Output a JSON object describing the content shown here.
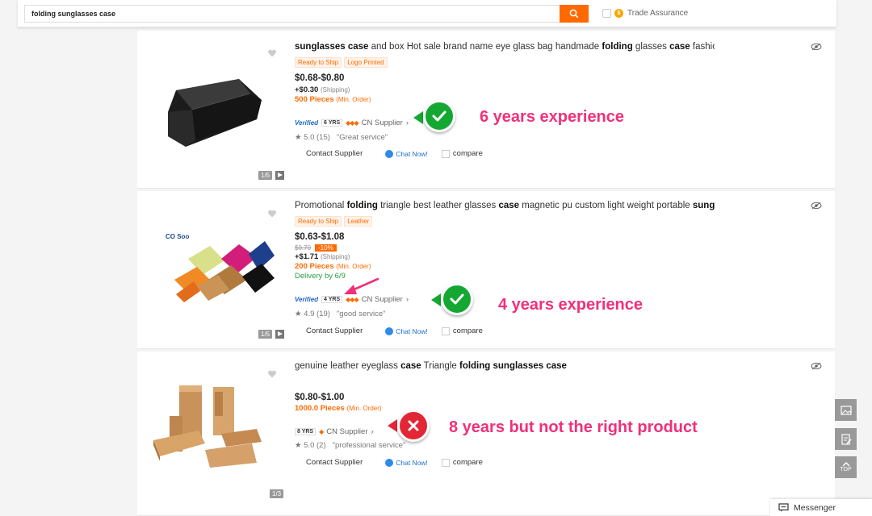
{
  "search": {
    "query": "folding sunglasses case",
    "trade_assurance_label": "Trade Assurance",
    "trade_assurance_badge": "$"
  },
  "products": [
    {
      "title_parts": [
        {
          "t": "sunglasses case",
          "b": true
        },
        {
          "t": " and box Hot sale brand name eye glass bag handmade ",
          "b": false
        },
        {
          "t": "folding",
          "b": true
        },
        {
          "t": " glasses ",
          "b": false
        },
        {
          "t": "case",
          "b": true
        },
        {
          "t": " fashion s...",
          "b": false
        }
      ],
      "tags": [
        "Ready to Ship",
        "Logo Printed"
      ],
      "price": "$0.68-$0.80",
      "shipping": "+$0.30",
      "shipping_label": "(Shipping)",
      "moq": "500 Pieces",
      "moq_label": "(Min. Order)",
      "verified": "Verified",
      "years": "6 YRS",
      "supplier": "CN Supplier",
      "rating": "5.0 (15)",
      "review": "\"Great service\"",
      "image_count": "1/5",
      "annotation": "6 years experience"
    },
    {
      "title_parts": [
        {
          "t": "Promotional ",
          "b": false
        },
        {
          "t": "folding",
          "b": true
        },
        {
          "t": " triangle best leather glasses ",
          "b": false
        },
        {
          "t": "case",
          "b": true
        },
        {
          "t": " magnetic pu custom light weight portable ",
          "b": false
        },
        {
          "t": "sungl...",
          "b": true
        }
      ],
      "tags": [
        "Ready to Ship",
        "Leather"
      ],
      "price": "$0.63-$1.08",
      "old_price": "$0.70",
      "discount": "-10%",
      "shipping": "+$1.71",
      "shipping_label": "(Shipping)",
      "moq": "200 Pieces",
      "moq_label": "(Min. Order)",
      "delivery": "Delivery by 6/9",
      "verified": "Verified",
      "years": "4 YRS",
      "supplier": "CN Supplier",
      "rating": "4.9 (19)",
      "review": "\"good service\"",
      "image_count": "1/5",
      "logo_text": "CO Soo",
      "annotation": "4 years experience"
    },
    {
      "title_parts": [
        {
          "t": "genuine leather eyeglass ",
          "b": false
        },
        {
          "t": "case",
          "b": true
        },
        {
          "t": " Triangle ",
          "b": false
        },
        {
          "t": "folding sunglasses case",
          "b": true
        }
      ],
      "price": "$0.80-$1.00",
      "moq": "1000.0 Pieces",
      "moq_label": "(Min. Order)",
      "years": "8 YRS",
      "supplier": "CN Supplier",
      "rating": "5.0 (2)",
      "review": "\"professional service\"",
      "image_count": "1/3",
      "annotation": "8 years but not the right product"
    }
  ],
  "actions": {
    "contact": "Contact Supplier",
    "chat": "Chat Now!",
    "compare": "compare"
  },
  "rail": {
    "top_label": "TOP"
  },
  "messenger": {
    "label": "Messenger"
  },
  "colors": {
    "accent": "#ff6a00",
    "annotation_text": "#f0307a",
    "annotation_ok": "#14a833",
    "annotation_bad": "#e32636",
    "verified": "#1f68c5",
    "delivery": "#25a244"
  }
}
